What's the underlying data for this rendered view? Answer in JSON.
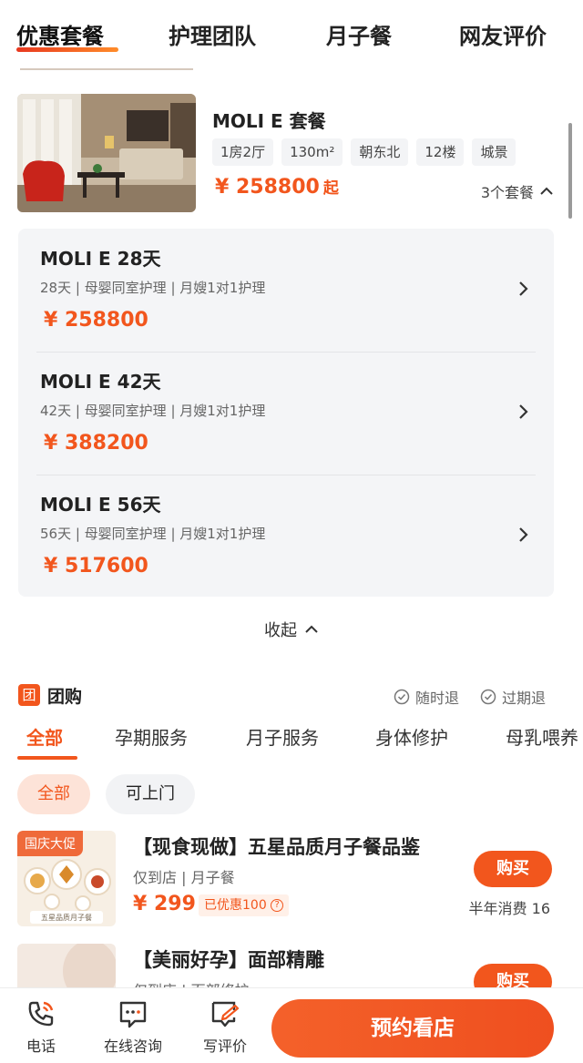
{
  "top_tabs": [
    "优惠套餐",
    "护理团队",
    "月子餐",
    "网友评价"
  ],
  "package": {
    "title": "MOLI  E 套餐",
    "tags": [
      "1房2厅",
      "130m²",
      "朝东北",
      "12楼",
      "城景"
    ],
    "price": "¥ 258800",
    "price_suffix": "起",
    "count": "3个套餐"
  },
  "items": [
    {
      "name": "MOLI  E 28天",
      "desc": "28天 | 母婴同室护理 | 月嫂1对1护理",
      "price": "¥ 258800"
    },
    {
      "name": "MOLI E 42天",
      "desc": "42天 | 母婴同室护理 | 月嫂1对1护理",
      "price": "¥ 388200"
    },
    {
      "name": "MOLI E 56天",
      "desc": "56天 | 母婴同室护理 | 月嫂1对1护理",
      "price": "¥ 517600"
    }
  ],
  "collapse_label": "收起",
  "group": {
    "icon_char": "团",
    "title": "团购",
    "guarantees": [
      "随时退",
      "过期退"
    ]
  },
  "category_tabs": [
    "全部",
    "孕期服务",
    "月子服务",
    "身体修护",
    "母乳喂养"
  ],
  "filters": [
    "全部",
    "可上门"
  ],
  "deals": [
    {
      "badge": "国庆大促",
      "title": "【现食现做】五星品质月子餐品鉴",
      "sub": "仅到店 | 月子餐",
      "price": "¥ 299",
      "discount": "已优惠100",
      "buy": "购买",
      "sales": "半年消费 16",
      "img_caption": "五星品质月子餐"
    },
    {
      "badge": "",
      "title": "【美丽好孕】面部精雕",
      "sub": "仅到店 | 面部修护",
      "price": "",
      "discount": "",
      "buy": "购买",
      "sales": ""
    }
  ],
  "bottom_bar": {
    "items": [
      {
        "icon": "phone-icon",
        "label": "电话"
      },
      {
        "icon": "chat-icon",
        "label": "在线咨询"
      },
      {
        "icon": "review-icon",
        "label": "写评价"
      }
    ],
    "reserve": "预约看店"
  },
  "colors": {
    "accent": "#f2561d",
    "panel": "#f4f5f7"
  }
}
